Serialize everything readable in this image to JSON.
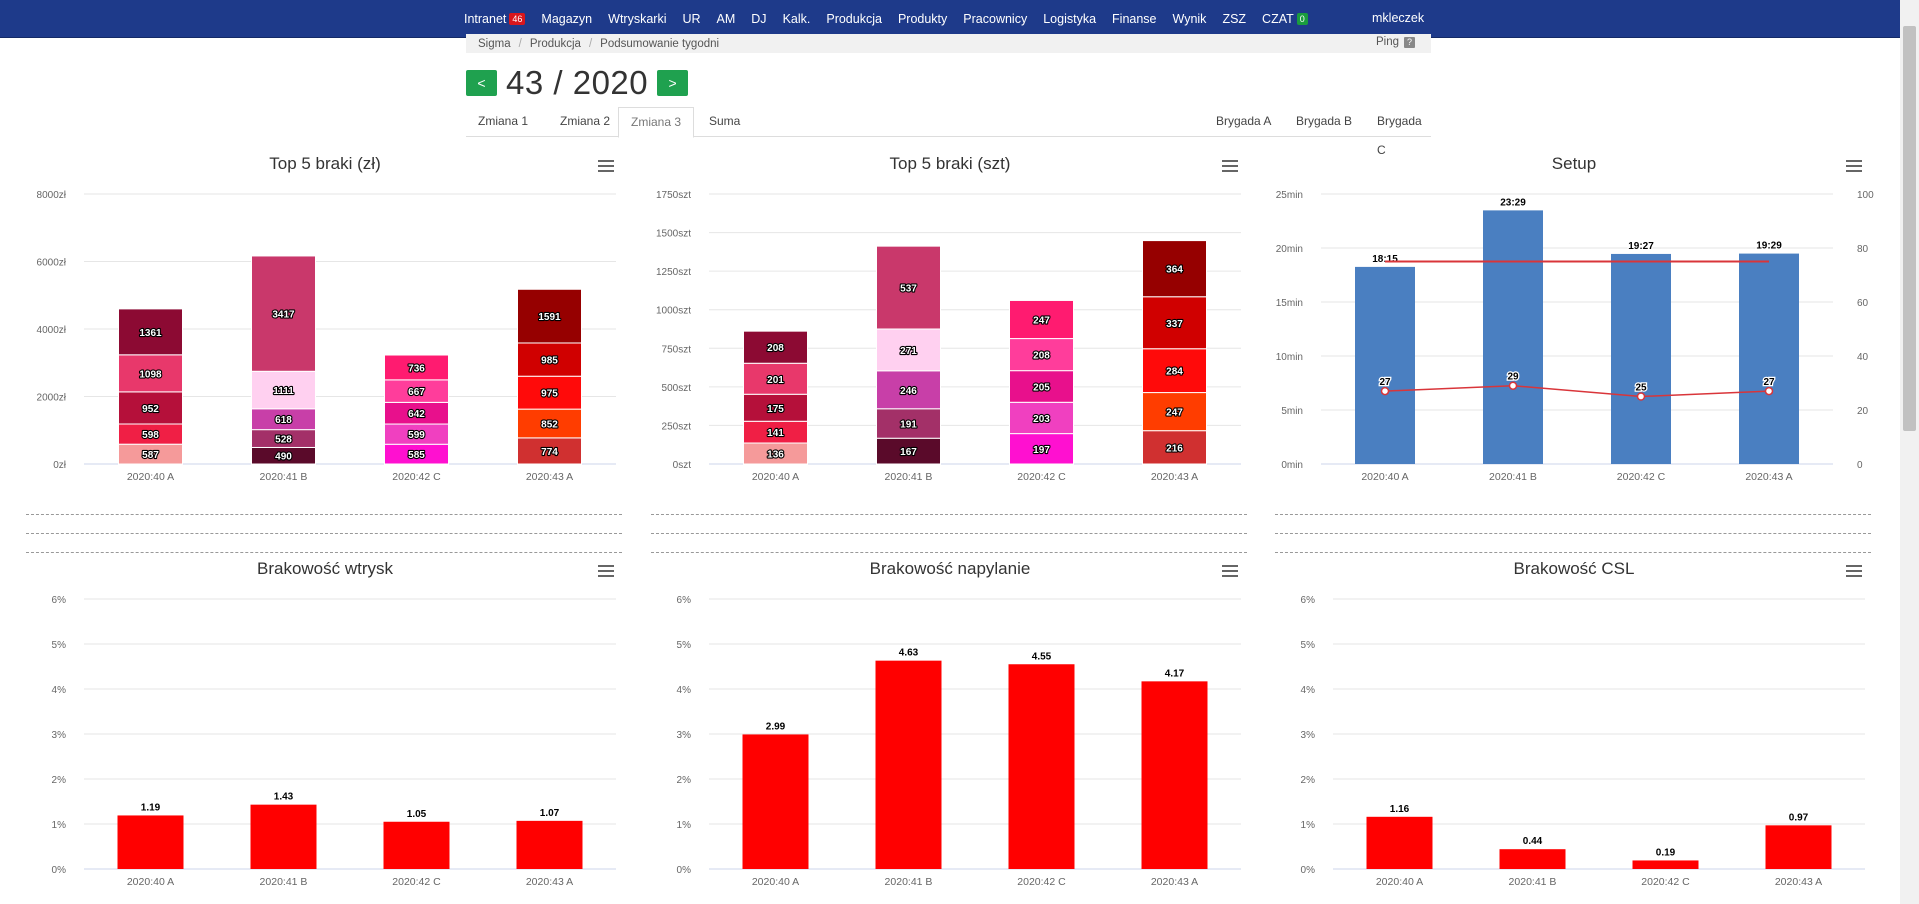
{
  "nav": {
    "items": [
      {
        "label": "Intranet",
        "badge": "46",
        "badge_color": "red"
      },
      {
        "label": "Magazyn"
      },
      {
        "label": "Wtryskarki"
      },
      {
        "label": "UR"
      },
      {
        "label": "AM"
      },
      {
        "label": "DJ"
      },
      {
        "label": "Kalk."
      },
      {
        "label": "Produkcja"
      },
      {
        "label": "Produkty"
      },
      {
        "label": "Pracownicy"
      },
      {
        "label": "Logistyka"
      },
      {
        "label": "Finanse"
      },
      {
        "label": "Wynik"
      },
      {
        "label": "ZSZ"
      },
      {
        "label": "CZAT",
        "badge": "0",
        "badge_color": "green"
      }
    ],
    "user": "mkleczek"
  },
  "breadcrumb": [
    "Sigma",
    "Produkcja",
    "Podsumowanie tygodni"
  ],
  "ping": {
    "label": "Ping",
    "help": "?"
  },
  "week": {
    "prev": "<",
    "title": "43 / 2020",
    "next": ">"
  },
  "tabs": [
    "Zmiana 1",
    "Zmiana 2",
    "Zmiana 3",
    "Suma"
  ],
  "active_tab": "Zmiana 3",
  "brigades": [
    "Brygada A",
    "Brygada B",
    "Brygada C"
  ],
  "colors": {
    "navbar": "#1e3a8a",
    "nav_button": "#1fa14f",
    "setup_bar": "#4a7fc1",
    "setup_line": "#d9353a",
    "scrap_bar": "#ff0000"
  },
  "chart_data": [
    {
      "id": "top5-zl",
      "type": "bar",
      "stacked": true,
      "title": "Top 5 braki (zł)",
      "categories": [
        "2020:40 A",
        "2020:41 B",
        "2020:42 C",
        "2020:43 A"
      ],
      "ylim": [
        0,
        8000
      ],
      "yticks": [
        0,
        2000,
        4000,
        6000,
        8000
      ],
      "yunit": "zł",
      "stacks": [
        [
          {
            "value": 587,
            "color": "#f59a9a"
          },
          {
            "value": 598,
            "color": "#f01f45"
          },
          {
            "value": 952,
            "color": "#b5103a"
          },
          {
            "value": 1098,
            "color": "#e8386b"
          },
          {
            "value": 1361,
            "color": "#8c0a33"
          }
        ],
        [
          {
            "value": 490,
            "color": "#5a0a2a"
          },
          {
            "value": 528,
            "color": "#a33068"
          },
          {
            "value": 618,
            "color": "#c83fa8"
          },
          {
            "value": 1111,
            "color": "#ffd0f0"
          },
          {
            "value": 3417,
            "color": "#c9386b"
          }
        ],
        [
          {
            "value": 585,
            "color": "#ff10d0"
          },
          {
            "value": 599,
            "color": "#f040c0"
          },
          {
            "value": 642,
            "color": "#e8108c"
          },
          {
            "value": 667,
            "color": "#ff3d9b"
          },
          {
            "value": 736,
            "color": "#ff1b70"
          }
        ],
        [
          {
            "value": 774,
            "color": "#d03030"
          },
          {
            "value": 852,
            "color": "#ff3d00"
          },
          {
            "value": 975,
            "color": "#ff0a0a"
          },
          {
            "value": 985,
            "color": "#d00000"
          },
          {
            "value": 1591,
            "color": "#960000"
          }
        ]
      ]
    },
    {
      "id": "top5-szt",
      "type": "bar",
      "stacked": true,
      "title": "Top 5 braki (szt)",
      "categories": [
        "2020:40 A",
        "2020:41 B",
        "2020:42 C",
        "2020:43 A"
      ],
      "ylim": [
        0,
        1750
      ],
      "yticks": [
        0,
        250,
        500,
        750,
        1000,
        1250,
        1500,
        1750
      ],
      "yunit": "szt",
      "stacks": [
        [
          {
            "value": 136,
            "color": "#f59a9a"
          },
          {
            "value": 141,
            "color": "#f01f45"
          },
          {
            "value": 175,
            "color": "#b5103a"
          },
          {
            "value": 201,
            "color": "#e8386b"
          },
          {
            "value": 208,
            "color": "#8c0a33"
          }
        ],
        [
          {
            "value": 167,
            "color": "#5a0a2a"
          },
          {
            "value": 191,
            "color": "#a33068"
          },
          {
            "value": 246,
            "color": "#c83fa8"
          },
          {
            "value": 271,
            "color": "#ffd0f0"
          },
          {
            "value": 537,
            "color": "#c9386b"
          }
        ],
        [
          {
            "value": 197,
            "color": "#ff10d0"
          },
          {
            "value": 203,
            "color": "#f040c0"
          },
          {
            "value": 205,
            "color": "#e8108c"
          },
          {
            "value": 208,
            "color": "#ff3d9b"
          },
          {
            "value": 247,
            "color": "#ff1b70"
          }
        ],
        [
          {
            "value": 216,
            "color": "#d03030"
          },
          {
            "value": 247,
            "color": "#ff3d00"
          },
          {
            "value": 284,
            "color": "#ff0a0a"
          },
          {
            "value": 337,
            "color": "#d00000"
          },
          {
            "value": 364,
            "color": "#960000"
          }
        ]
      ]
    },
    {
      "id": "setup",
      "type": "bar+line",
      "title": "Setup",
      "categories": [
        "2020:40 A",
        "2020:41 B",
        "2020:42 C",
        "2020:43 A"
      ],
      "bar_values_min": [
        18.25,
        23.483,
        19.45,
        19.483
      ],
      "bar_labels": [
        "18:15",
        "23:29",
        "19:27",
        "19:29"
      ],
      "ylim": [
        0,
        25
      ],
      "yticks": [
        0,
        5,
        10,
        15,
        20,
        25
      ],
      "yunit": "min",
      "y2lim": [
        0,
        100
      ],
      "y2ticks": [
        0,
        20,
        40,
        60,
        80,
        100
      ],
      "line_values": [
        27,
        29,
        25,
        27
      ],
      "target_y2": 75
    },
    {
      "id": "brak-wtrysk",
      "type": "bar",
      "title": "Brakowość wtrysk",
      "categories": [
        "2020:40 A",
        "2020:41 B",
        "2020:42 C",
        "2020:43 A"
      ],
      "values": [
        1.19,
        1.43,
        1.05,
        1.07
      ],
      "ylim": [
        0,
        6
      ],
      "yticks": [
        0,
        1,
        2,
        3,
        4,
        5,
        6
      ],
      "yunit": "%"
    },
    {
      "id": "brak-napylanie",
      "type": "bar",
      "title": "Brakowość napylanie",
      "categories": [
        "2020:40 A",
        "2020:41 B",
        "2020:42 C",
        "2020:43 A"
      ],
      "values": [
        2.99,
        4.63,
        4.55,
        4.17
      ],
      "ylim": [
        0,
        6
      ],
      "yticks": [
        0,
        1,
        2,
        3,
        4,
        5,
        6
      ],
      "yunit": "%"
    },
    {
      "id": "brak-csl",
      "type": "bar",
      "title": "Brakowość CSL",
      "categories": [
        "2020:40 A",
        "2020:41 B",
        "2020:42 C",
        "2020:43 A"
      ],
      "values": [
        1.16,
        0.44,
        0.19,
        0.97
      ],
      "ylim": [
        0,
        6
      ],
      "yticks": [
        0,
        1,
        2,
        3,
        4,
        5,
        6
      ],
      "yunit": "%"
    }
  ]
}
